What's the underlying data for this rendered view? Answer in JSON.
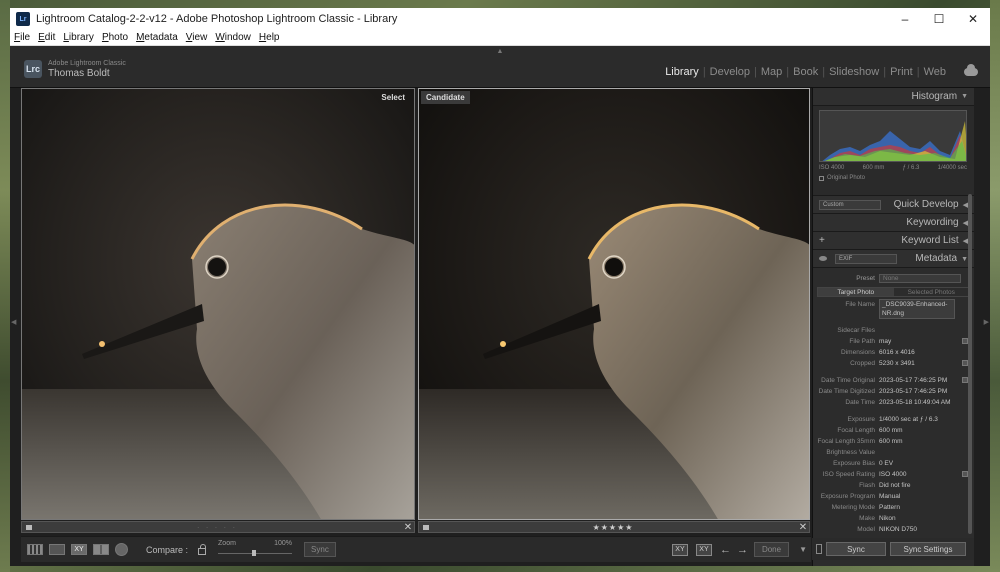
{
  "window": {
    "title": "Lightroom Catalog-2-2-v12 - Adobe Photoshop Lightroom Classic - Library",
    "app_icon_text": "Lr",
    "controls": [
      "–",
      "☐",
      "✕"
    ]
  },
  "menu": [
    "File",
    "Edit",
    "Library",
    "Photo",
    "Metadata",
    "View",
    "Window",
    "Help"
  ],
  "identity": {
    "badge": "Lrc",
    "product": "Adobe Lightroom Classic",
    "user": "Thomas Boldt"
  },
  "modules": [
    "Library",
    "Develop",
    "Map",
    "Book",
    "Slideshow",
    "Print",
    "Web"
  ],
  "active_module": "Library",
  "panes": {
    "select_label": "Select",
    "candidate_label": "Candidate",
    "candidate_rating_stars": "★★★★★",
    "select_rating_dots": "· · · · ·"
  },
  "toolbar": {
    "compare_label": "Compare :",
    "zoom_label": "Zoom",
    "zoom_value": "100%",
    "zoom_fraction": 1.0,
    "sync_label": "Sync",
    "done_label": "Done",
    "xy_label": "XY",
    "swap_label": "XY"
  },
  "histogram": {
    "title": "Histogram",
    "iso": "ISO 4000",
    "focal": "600 mm",
    "aperture": "ƒ / 6.3",
    "shutter": "1/4000 sec",
    "original_photo": "Original Photo"
  },
  "panels": {
    "quick_develop": "Quick Develop",
    "quick_develop_preset": "Custom",
    "keywording": "Keywording",
    "keyword_list": "Keyword List",
    "metadata": "Metadata",
    "metadata_set": "EXIF"
  },
  "metadata": {
    "preset_label": "Preset",
    "preset_value": "None",
    "tab_target": "Target Photo",
    "tab_selected": "Selected Photos",
    "file_name_label": "File Name",
    "file_name": "_DSC9039-Enhanced-NR.dng",
    "rows_a": [
      {
        "k": "Sidecar Files",
        "v": ""
      },
      {
        "k": "File Path",
        "v": "may"
      },
      {
        "k": "Dimensions",
        "v": "6016 x 4016"
      },
      {
        "k": "Cropped",
        "v": "5230 x 3491"
      }
    ],
    "rows_b": [
      {
        "k": "Date Time Original",
        "v": "2023-05-17 7:46:25 PM"
      },
      {
        "k": "Date Time Digitized",
        "v": "2023-05-17 7:46:25 PM"
      },
      {
        "k": "Date Time",
        "v": "2023-05-18 10:49:04 AM"
      }
    ],
    "rows_c": [
      {
        "k": "Exposure",
        "v": "1/4000 sec at ƒ / 6.3"
      },
      {
        "k": "Focal Length",
        "v": "600 mm"
      },
      {
        "k": "Focal Length 35mm",
        "v": "600 mm"
      },
      {
        "k": "Brightness Value",
        "v": ""
      },
      {
        "k": "Exposure Bias",
        "v": "0 EV"
      },
      {
        "k": "ISO Speed Rating",
        "v": "ISO 4000"
      },
      {
        "k": "Flash",
        "v": "Did not fire"
      },
      {
        "k": "Exposure Program",
        "v": "Manual"
      },
      {
        "k": "Metering Mode",
        "v": "Pattern"
      },
      {
        "k": "Make",
        "v": "Nikon"
      },
      {
        "k": "Model",
        "v": "NIKON D750"
      }
    ]
  },
  "sync_bar": {
    "sync": "Sync",
    "sync_settings": "Sync Settings"
  }
}
